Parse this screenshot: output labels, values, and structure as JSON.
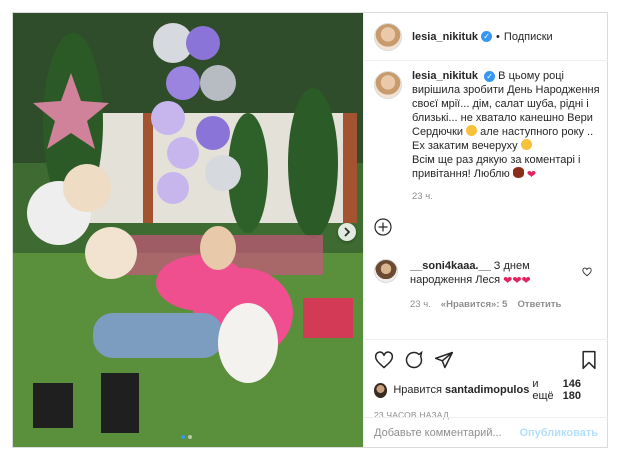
{
  "post": {
    "username": "lesia_nikituk",
    "follow_label": "Подписки",
    "separator": "•",
    "verified_mark": "✓"
  },
  "caption": {
    "username": "lesia_nikituk",
    "text_line1": "В цьому році вирішила зробити День Народження своєї мрії... дім, салат шуба, рідні і близькі... не хватало канешно Вери Сердючки",
    "text_line2": "але наступного року .. Ех закатим вечеруху",
    "text_line3": "Всім ще раз дякую за коментарі і привітання! Люблю",
    "time": "23 ч."
  },
  "reply": {
    "username": "__soni4kaaa.__",
    "text": "З днем народження Леся",
    "hearts": "❤❤❤",
    "time": "23 ч.",
    "likes_label": "«Нравится»: 5",
    "reply_label": "Ответить"
  },
  "likes": {
    "prefix": "Нравится",
    "user": "santadimopulos",
    "middle": "и ещё",
    "count": "146 180"
  },
  "posted_ago": "23 ЧАСОВ НАЗАД",
  "add_comment": {
    "placeholder": "Добавьте комментарий...",
    "publish_label": "Опубликовать"
  },
  "carousel": {
    "total": 2,
    "active": 1
  },
  "colors": {
    "accent": "#3897f0",
    "heart": "#e0245e",
    "muted": "#8e8e8e"
  },
  "icons": [
    "verified-icon",
    "add-icon",
    "heart-icon",
    "comment-icon",
    "share-icon",
    "bookmark-icon",
    "chevron-right-icon"
  ]
}
